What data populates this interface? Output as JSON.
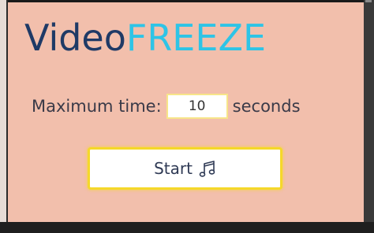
{
  "app": {
    "title_part1": "Video",
    "title_part2": "FREEZE",
    "colors": {
      "panel_background": "#f2bfac",
      "title_primary": "#1f3a66",
      "title_accent": "#2ec4e6",
      "button_border": "#f5d82a"
    }
  },
  "settings": {
    "max_time_label": "Maximum time:",
    "max_time_value": "10",
    "unit_label": "seconds"
  },
  "actions": {
    "start_label": "Start",
    "start_icon": "music-note-icon"
  }
}
